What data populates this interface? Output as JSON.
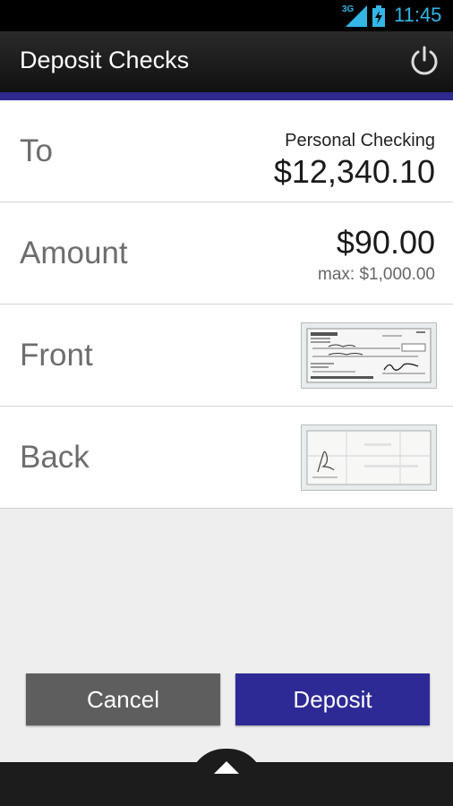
{
  "status_bar": {
    "network": "3G",
    "time": "11:45",
    "accent_color": "#33b5e5"
  },
  "action_bar": {
    "title": "Deposit Checks",
    "power_icon": "power-icon",
    "accent_color": "#2e2a8f"
  },
  "rows": {
    "to": {
      "label": "To",
      "account": "Personal Checking",
      "balance": "$12,340.10"
    },
    "amount": {
      "label": "Amount",
      "value": "$90.00",
      "max": "max: $1,000.00"
    },
    "front": {
      "label": "Front"
    },
    "back": {
      "label": "Back"
    }
  },
  "buttons": {
    "cancel_label": "Cancel",
    "deposit_label": "Deposit",
    "cancel_color": "#5e5e5e",
    "deposit_color": "#2e2a95"
  },
  "bottom": {
    "handle_icon": "chevron-up-icon"
  }
}
